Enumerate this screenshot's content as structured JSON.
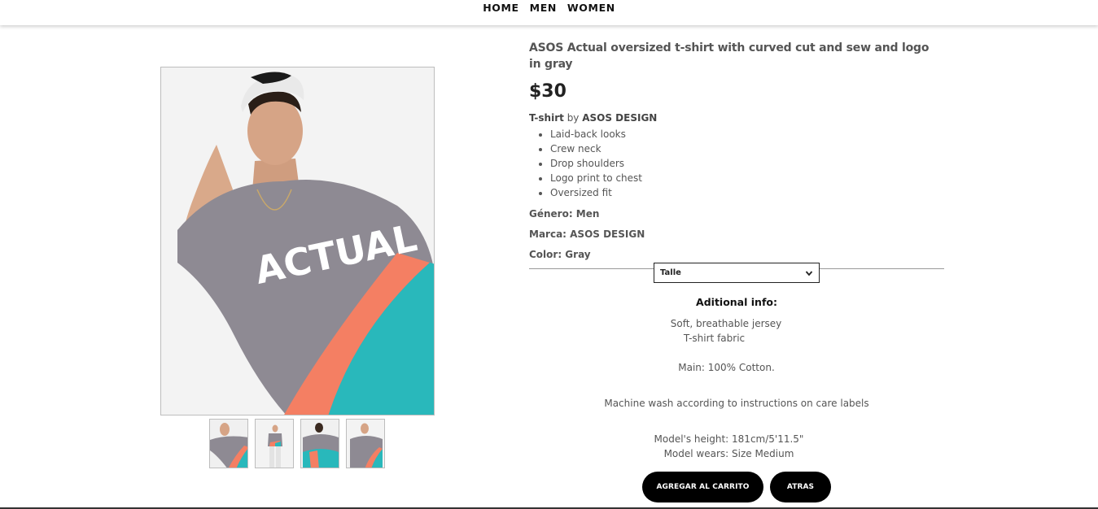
{
  "nav": {
    "items": [
      "HOME",
      "MEN",
      "WOMEN"
    ]
  },
  "product": {
    "title": "ASOS Actual oversized t-shirt with curved cut and sew and logo in gray",
    "price": "$30",
    "type": "T-shirt",
    "by": "by",
    "brand": "ASOS DESIGN",
    "features": [
      "Laid-back looks",
      "Crew neck",
      "Drop shoulders",
      "Logo print to chest",
      "Oversized fit"
    ],
    "genero": "Género: Men",
    "marca": "Marca: ASOS DESIGN",
    "color": "Color: Gray"
  },
  "size_select": {
    "value": "Talle"
  },
  "additional": {
    "title": "Aditional info:",
    "line1": "Soft, breathable jersey",
    "line2": "T-shirt fabric",
    "line3": "Main: 100% Cotton.",
    "line4": "Machine wash according to instructions on care labels",
    "line5": "Model's height: 181cm/5'11.5\"",
    "line6": "Model wears: Size Medium"
  },
  "buttons": {
    "add": "AGREGAR AL CARRITO",
    "back": "ATRAS"
  },
  "colors": {
    "shirt_gray": "#8e8a93",
    "coral": "#f47f63",
    "teal": "#29b8bb",
    "button_bg": "#000000"
  }
}
